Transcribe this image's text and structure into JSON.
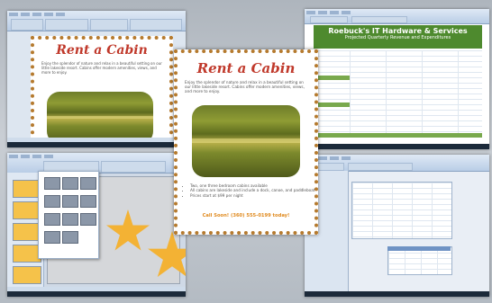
{
  "flyer": {
    "title": "Rent a Cabin",
    "intro": "Enjoy the splendor of nature and relax in a beautiful setting on our little lakeside resort. Cabins offer modern amenities, views, and more to enjoy.",
    "bullets": [
      "Two, one three bedroom cabins available",
      "All cabins are lakeside and include a dock, canoe, and paddleboat",
      "Prices start at $99 per night"
    ],
    "cta": "Call Soon! (360) 555-0199 today!"
  },
  "excel": {
    "title": "Roebuck's IT Hardware & Services",
    "subtitle": "Projected Quarterly Revenue and Expenditures"
  },
  "colors": {
    "desktop": "#b9c0c8",
    "ribbon": "#b9cde6",
    "flyer_border": "#b57a2e",
    "flyer_title": "#c0392b",
    "excel_header": "#4e8a2e",
    "sun": "#f3b234"
  }
}
